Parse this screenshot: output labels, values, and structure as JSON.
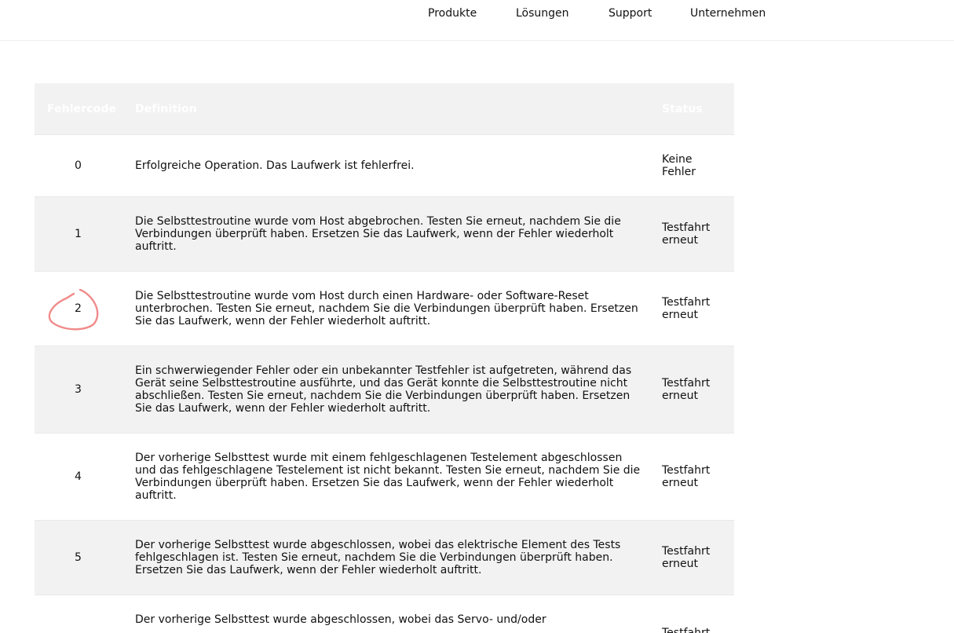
{
  "nav": {
    "items": [
      {
        "label": "Produkte"
      },
      {
        "label": "Lösungen"
      },
      {
        "label": "Support"
      },
      {
        "label": "Unternehmen"
      }
    ]
  },
  "table": {
    "headers": {
      "code": "Fehlercode",
      "definition": "Definition",
      "status": "Status"
    },
    "rows": [
      {
        "code": "0",
        "definition": "Erfolgreiche Operation. Das Laufwerk ist fehlerfrei.",
        "status": "Keine Fehler"
      },
      {
        "code": "1",
        "definition": "Die Selbsttestroutine wurde vom Host abgebrochen. Testen Sie erneut, nachdem Sie die Verbindungen überprüft haben. Ersetzen Sie das Laufwerk, wenn der Fehler wiederholt auftritt.",
        "status": "Testfahrt erneut"
      },
      {
        "code": "2",
        "definition": "Die Selbsttestroutine wurde vom Host durch einen Hardware- oder Software-Reset unterbrochen. Testen Sie erneut, nachdem Sie die Verbindungen überprüft haben. Ersetzen Sie das Laufwerk, wenn der Fehler wiederholt auftritt.",
        "status": "Testfahrt erneut"
      },
      {
        "code": "3",
        "definition": "Ein schwerwiegender Fehler oder ein unbekannter Testfehler ist aufgetreten, während das Gerät seine Selbsttestroutine ausführte, und das Gerät konnte die Selbsttestroutine nicht abschließen. Testen Sie erneut, nachdem Sie die Verbindungen überprüft haben. Ersetzen Sie das Laufwerk, wenn der Fehler wiederholt auftritt.",
        "status": "Testfahrt erneut"
      },
      {
        "code": "4",
        "definition": "Der vorherige Selbsttest wurde mit einem fehlgeschlagenen Testelement abgeschlossen und das fehlgeschlagene Testelement ist nicht bekannt. Testen Sie erneut, nachdem Sie die Verbindungen überprüft haben. Ersetzen Sie das Laufwerk, wenn der Fehler wiederholt auftritt.",
        "status": "Testfahrt erneut"
      },
      {
        "code": "5",
        "definition": "Der vorherige Selbsttest wurde abgeschlossen, wobei das elektrische Element des Tests fehlgeschlagen ist. Testen Sie erneut, nachdem Sie die Verbindungen überprüft haben. Ersetzen Sie das Laufwerk, wenn der Fehler wiederholt auftritt.",
        "status": "Testfahrt erneut"
      },
      {
        "code": "",
        "definition": "Der vorherige Selbsttest wurde abgeschlossen, wobei das Servo- und/oder",
        "status": "Testfahrt"
      }
    ]
  },
  "colors": {
    "header_bg": "#f2f2f2",
    "alt_row_bg": "#f2f2f2",
    "annotation": "#f08a8a"
  }
}
